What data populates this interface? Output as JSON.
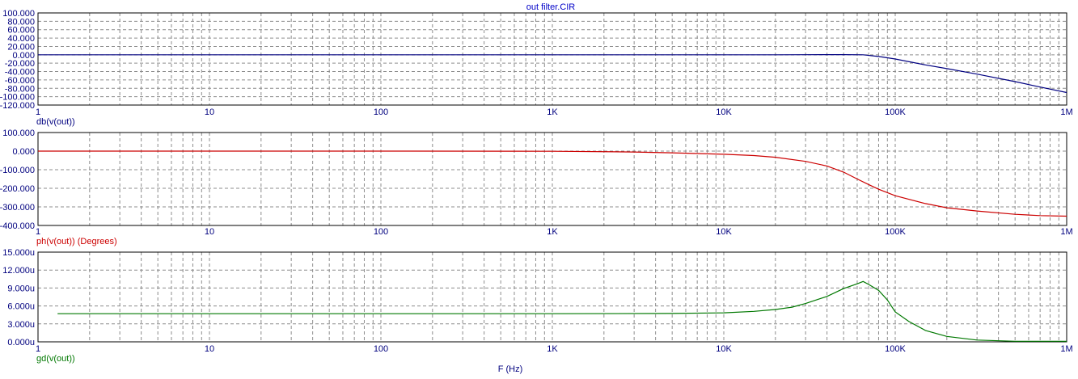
{
  "window": {
    "title": "out filter.CIR"
  },
  "xlabel": "F (Hz)",
  "x_ticks": [
    "1",
    "10",
    "100",
    "1K",
    "10K",
    "100K",
    "1M"
  ],
  "colors": {
    "axis_text": "#00007f",
    "grid": "#8c8c8c",
    "frame": "#000000"
  },
  "chart_data": [
    {
      "type": "line",
      "name": "db(v(out))",
      "xscale": "log",
      "xlim": [
        1,
        1000000
      ],
      "ylim": [
        -120,
        100
      ],
      "y_ticks": [
        "100.000",
        "80.000",
        "60.000",
        "40.000",
        "20.000",
        "0.000",
        "-20.000",
        "-40.000",
        "-60.000",
        "-80.000",
        "-100.000",
        "-120.000"
      ],
      "y_tick_values": [
        100,
        80,
        60,
        40,
        20,
        0,
        -20,
        -40,
        -60,
        -80,
        -100,
        -120
      ],
      "ylabel": "db(v(out))",
      "color": "#000080",
      "series": [
        {
          "name": "db(v(out))",
          "x": [
            1,
            10,
            100,
            1000,
            10000,
            20000,
            30000,
            50000,
            65000,
            80000,
            100000,
            150000,
            200000,
            300000,
            500000,
            700000,
            1000000
          ],
          "values": [
            0,
            0,
            0,
            0,
            0,
            0,
            0.3,
            0.5,
            0,
            -4,
            -10,
            -24,
            -33,
            -46,
            -64,
            -77,
            -90
          ]
        }
      ]
    },
    {
      "type": "line",
      "name": "ph(v(out)) (Degrees)",
      "xscale": "log",
      "xlim": [
        1,
        1000000
      ],
      "ylim": [
        -400,
        100
      ],
      "y_ticks": [
        "100.000",
        "0.000",
        "-100.000",
        "-200.000",
        "-300.000",
        "-400.000"
      ],
      "y_tick_values": [
        100,
        0,
        -100,
        -200,
        -300,
        -400
      ],
      "ylabel": "ph(v(out)) (Degrees)",
      "color": "#cc0000",
      "series": [
        {
          "name": "ph(v(out)) (Degrees)",
          "x": [
            1,
            100,
            1000,
            3000,
            5000,
            10000,
            15000,
            20000,
            30000,
            40000,
            50000,
            60000,
            70000,
            80000,
            100000,
            150000,
            200000,
            300000,
            500000,
            700000,
            1000000
          ],
          "values": [
            0,
            0,
            -1,
            -5,
            -9,
            -17,
            -24,
            -33,
            -55,
            -80,
            -113,
            -150,
            -180,
            -205,
            -240,
            -282,
            -305,
            -322,
            -340,
            -347,
            -350
          ]
        }
      ]
    },
    {
      "type": "line",
      "name": "gd(v(out))",
      "xscale": "log",
      "xlim": [
        1,
        1000000
      ],
      "ylim": [
        0,
        15
      ],
      "y_ticks": [
        "15.000u",
        "12.000u",
        "9.000u",
        "6.000u",
        "3.000u",
        "0.000u"
      ],
      "y_tick_values": [
        15,
        12,
        9,
        6,
        3,
        0
      ],
      "ylabel": "gd(v(out))",
      "color": "#007800",
      "series": [
        {
          "name": "gd(v(out))",
          "x": [
            1.3,
            10,
            100,
            1000,
            5000,
            10000,
            15000,
            20000,
            25000,
            30000,
            40000,
            50000,
            60000,
            65000,
            70000,
            80000,
            90000,
            100000,
            120000,
            150000,
            200000,
            300000,
            500000,
            1000000
          ],
          "values": [
            4.7,
            4.7,
            4.7,
            4.7,
            4.75,
            4.85,
            5.1,
            5.4,
            5.8,
            6.4,
            7.6,
            8.9,
            9.7,
            10.1,
            9.6,
            8.6,
            7.0,
            5.0,
            3.4,
            1.9,
            0.9,
            0.3,
            0.1,
            0.1
          ]
        }
      ]
    }
  ]
}
